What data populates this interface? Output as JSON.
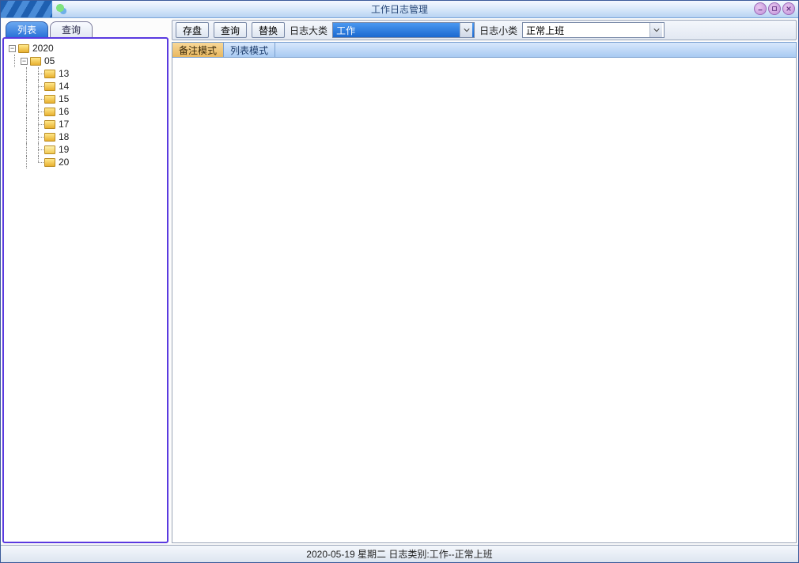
{
  "window": {
    "title": "工作日志管理"
  },
  "left_tabs": {
    "list": "列表",
    "query": "查询"
  },
  "tree": {
    "root": "2020",
    "month": "05",
    "days": [
      "13",
      "14",
      "15",
      "16",
      "17",
      "18",
      "19",
      "20"
    ]
  },
  "toolbar": {
    "save": "存盘",
    "query": "查询",
    "replace": "替换",
    "category_label": "日志大类",
    "category_value": "工作",
    "subcategory_label": "日志小类",
    "subcategory_value": "正常上班"
  },
  "sub_tabs": {
    "memo_mode": "备注模式",
    "list_mode": "列表模式"
  },
  "statusbar": {
    "text": "2020-05-19 星期二 日志类别:工作--正常上班"
  }
}
